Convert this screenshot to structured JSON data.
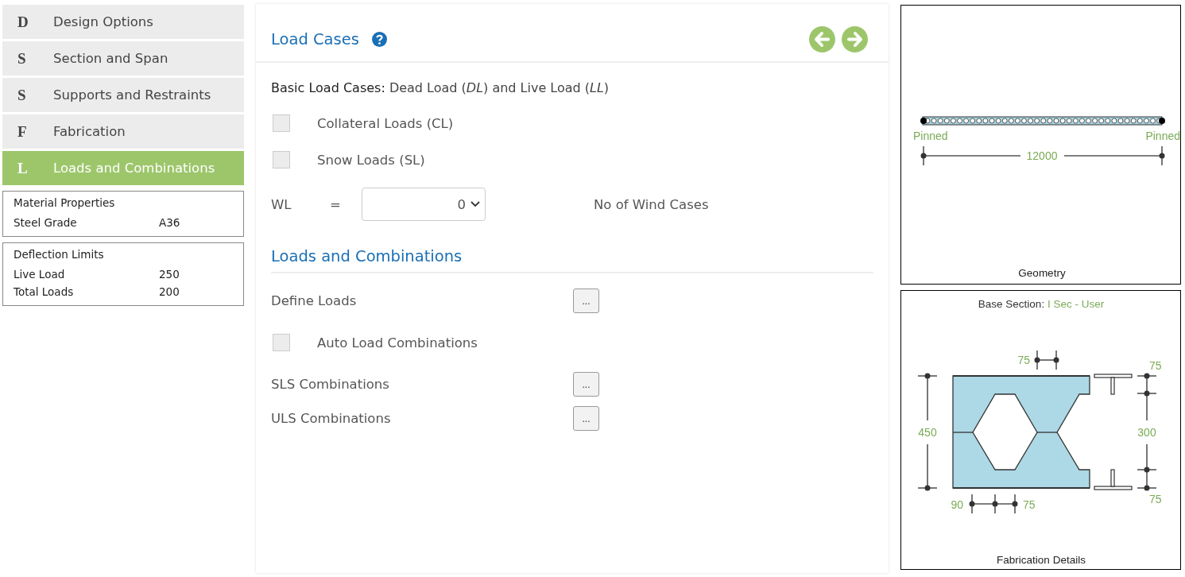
{
  "steps": [
    {
      "letter": "D",
      "label": "Design Options",
      "selected": false
    },
    {
      "letter": "S",
      "label": "Section and Span",
      "selected": false
    },
    {
      "letter": "S",
      "label": "Supports and Restraints",
      "selected": false
    },
    {
      "letter": "F",
      "label": "Fabrication",
      "selected": false
    },
    {
      "letter": "L",
      "label": "Loads and Combinations",
      "selected": true
    }
  ],
  "summary_cards": [
    {
      "title": "Material Properties",
      "rows": [
        {
          "label": "Steel Grade",
          "value": "A36"
        }
      ]
    },
    {
      "title": "Deflection Limits",
      "rows": [
        {
          "label": "Live Load",
          "value": "250"
        },
        {
          "label": "Total Loads",
          "value": "200"
        }
      ]
    }
  ],
  "load_cases": {
    "title": "Load Cases",
    "basic": "**Basic Load Cases:** Dead Load (*DL*) and Live Load (*LL*)",
    "options": [
      {
        "label": "Collateral Loads (CL)",
        "checked": false
      },
      {
        "label": "Snow Loads (SL)",
        "checked": false
      }
    ],
    "wind": {
      "label": "WL",
      "equals": "=",
      "value": "0",
      "hint": "No of Wind Cases"
    }
  },
  "combinations": {
    "title": "Loads and Combinations",
    "items": [
      {
        "kind": "button",
        "label": "Define Loads",
        "button": "..."
      },
      {
        "kind": "checkbox",
        "label": "Auto Load Combinations",
        "checked": false
      },
      {
        "kind": "button",
        "label": "SLS Combinations",
        "button": "..."
      },
      {
        "kind": "button",
        "label": "ULS Combinations",
        "button": "..."
      }
    ]
  },
  "geometry": {
    "left_support": "Pinned",
    "right_support": "Pinned",
    "span": "12000",
    "caption": "Geometry"
  },
  "fabrication": {
    "base_label": "Base Section:",
    "base_value": "I Sec - User",
    "dims": [
      "75",
      "75",
      "450",
      "300",
      "75",
      "90",
      "75"
    ],
    "caption": "Fabrication Details"
  }
}
